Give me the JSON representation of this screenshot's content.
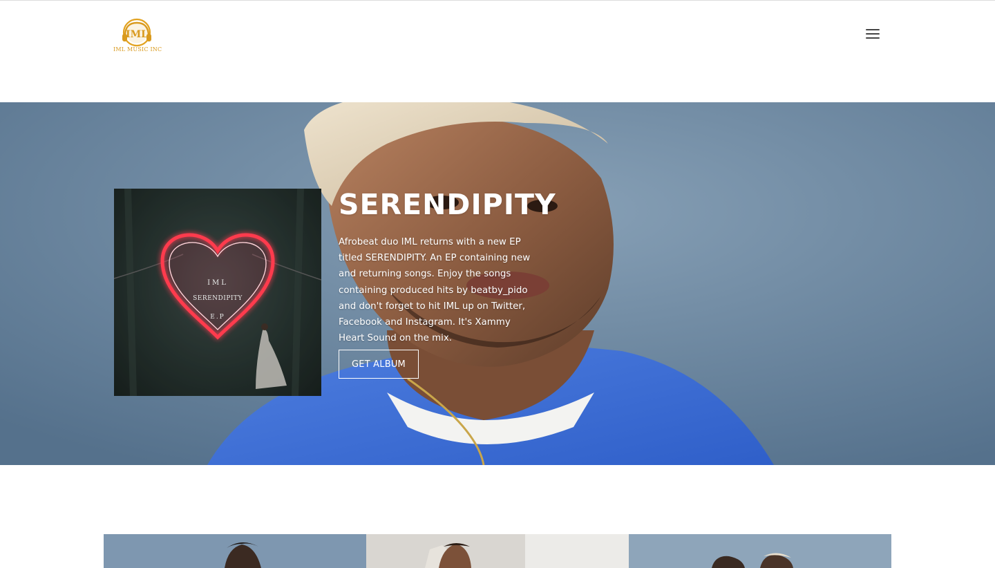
{
  "header": {
    "logo_text": "IML MUSIC INC",
    "logo_monogram": "IML",
    "menu_icon": "hamburger-menu-icon"
  },
  "hero": {
    "title": "SERENDIPITY",
    "description": "Afrobeat duo IML returns with a new EP titled SERENDIPITY. An EP containing new and returning songs. Enjoy the songs containing produced hits by beatby_pido and don't forget to hit IML up on Twitter, Facebook and Instagram. It's Xammy Heart Sound on the mix.",
    "cta_label": "GET ALBUM",
    "cover": {
      "line1": "IML",
      "line2": "SERENDIPITY",
      "line3": "E.P"
    }
  },
  "gallery": {
    "items": [
      "gallery-photo-1",
      "gallery-photo-2",
      "gallery-photo-3"
    ]
  },
  "colors": {
    "brand_gold": "#d99a1e",
    "hero_blue": "#6f8aa3",
    "neon_red": "#ff3b4e"
  }
}
